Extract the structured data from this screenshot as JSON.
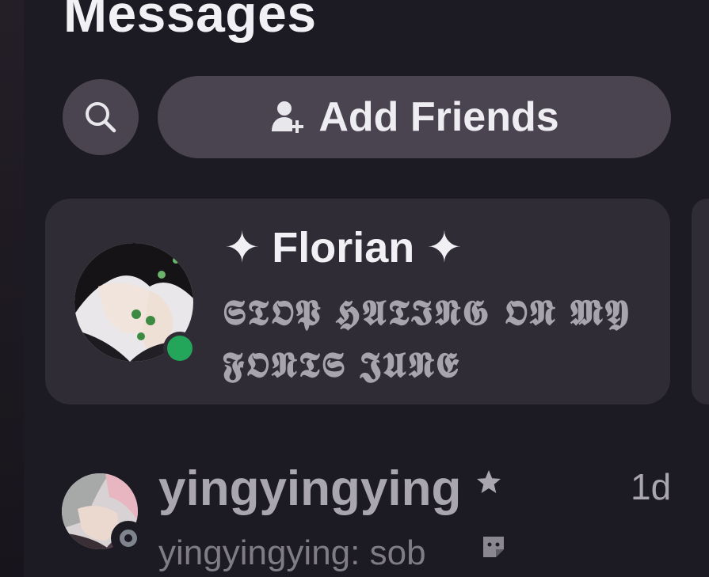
{
  "header": {
    "title": "Messages"
  },
  "toolbar": {
    "search_icon": "search-icon",
    "add_friends_icon": "add-person-icon",
    "add_friends_label": "Add Friends"
  },
  "featured": {
    "name": "✦ Florian ✦",
    "status_text": "𝕾𝕿𝕺𝕻 𝕳𝕬𝕿𝕴𝕹𝕲 𝕺𝕹 𝕸𝖄 𝕱𝕺𝕹𝕿𝕾 𝕵𝖀𝕹𝕰",
    "presence": "online",
    "presence_color": "#23a55a"
  },
  "dms": [
    {
      "name": "yingyingying",
      "star_icon": "star-icon",
      "time": "1d",
      "preview": "yingyingying: sob",
      "sticker_icon": "sticker-icon",
      "presence": "offline",
      "presence_color": "#80848e"
    }
  ],
  "colors": {
    "background": "#1c1a22",
    "button_bg": "#4a4450",
    "card_bg": "#2f2c35",
    "text_primary": "#f1f0f5",
    "text_secondary": "#a9a6af"
  }
}
